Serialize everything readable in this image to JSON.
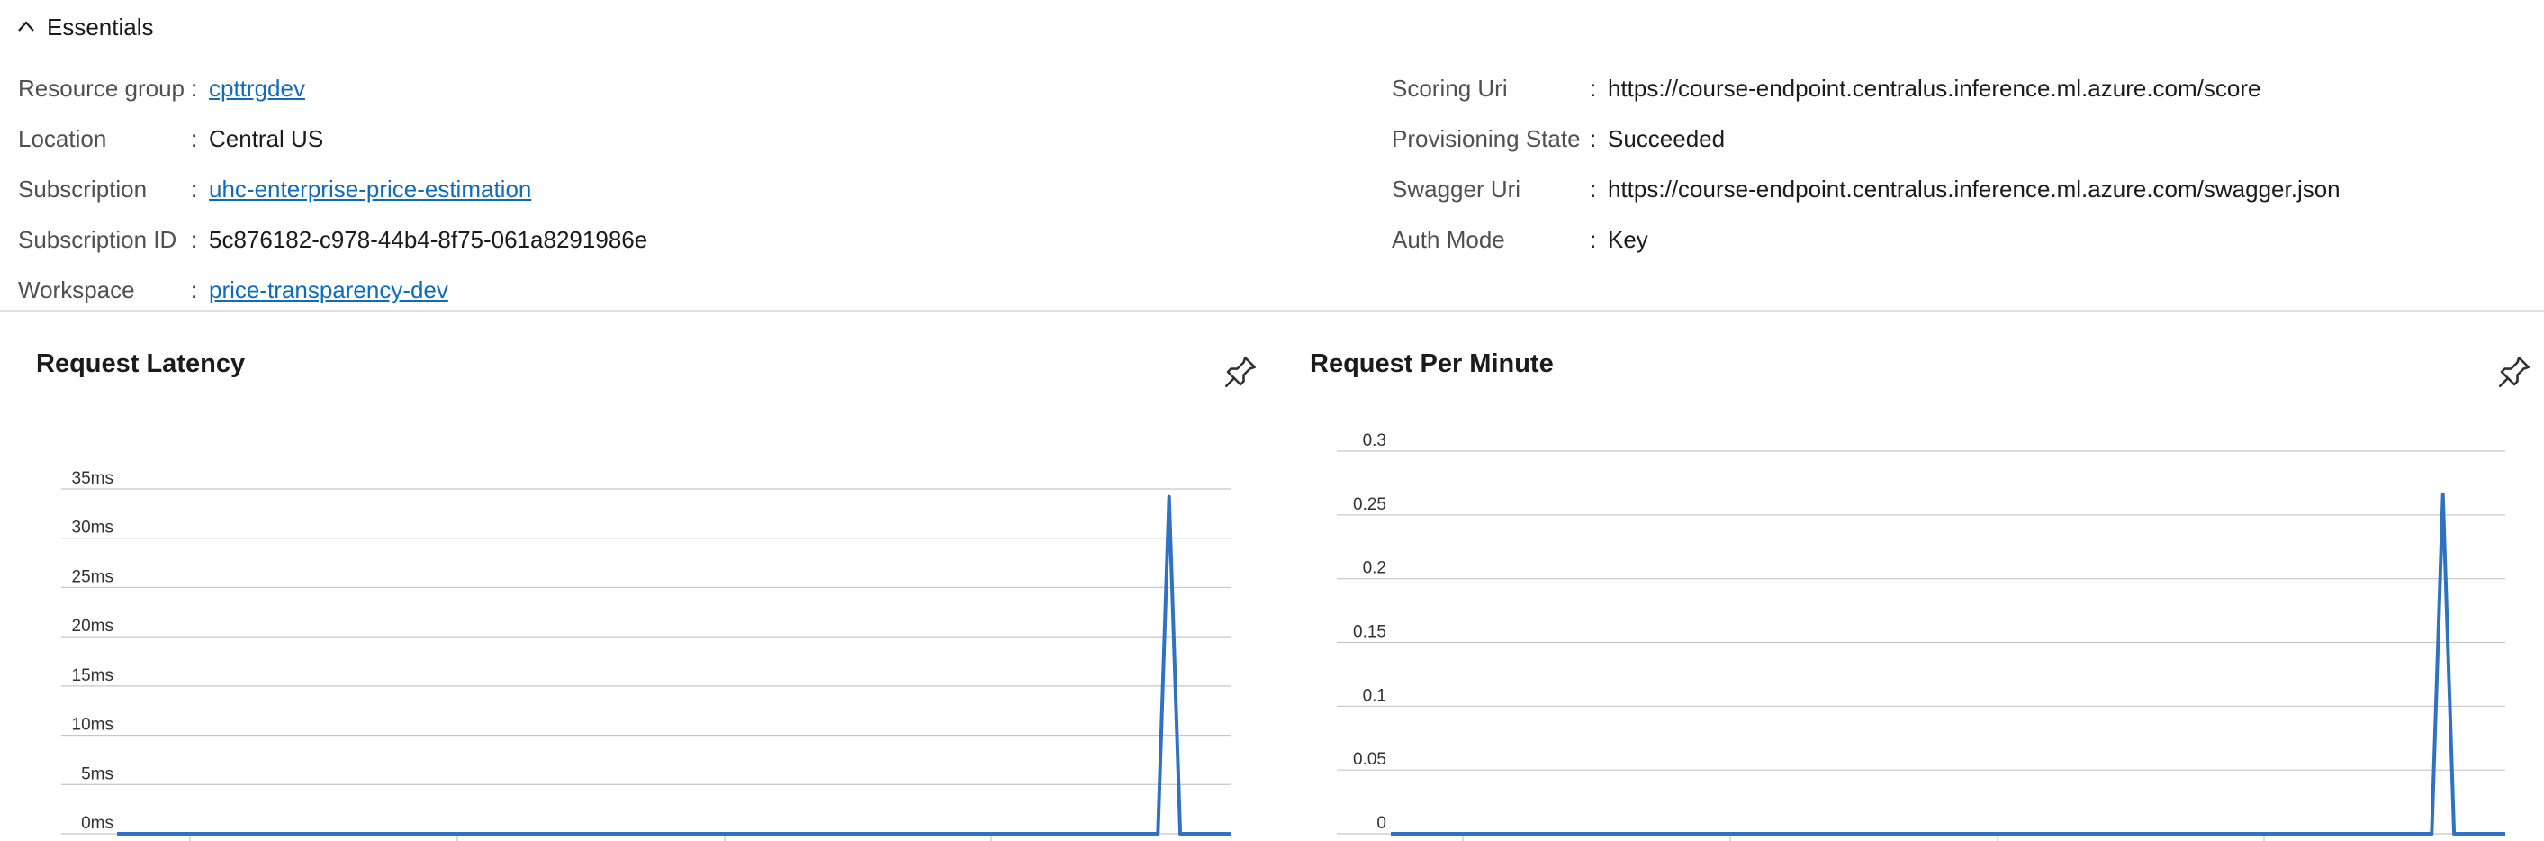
{
  "essentials": {
    "label": "Essentials"
  },
  "properties_left": [
    {
      "label": "Resource group",
      "value": "cpttrgdev",
      "link": true
    },
    {
      "label": "Location",
      "value": "Central US",
      "link": false
    },
    {
      "label": "Subscription",
      "value": "uhc-enterprise-price-estimation",
      "link": true
    },
    {
      "label": "Subscription ID",
      "value": "5c876182-c978-44b4-8f75-061a8291986e",
      "link": false
    },
    {
      "label": "Workspace",
      "value": "price-transparency-dev",
      "link": true
    }
  ],
  "properties_right": [
    {
      "label": "Scoring Uri",
      "value": "https://course-endpoint.centralus.inference.ml.azure.com/score",
      "link": false
    },
    {
      "label": "Provisioning State",
      "value": "Succeeded",
      "link": false
    },
    {
      "label": "Swagger Uri",
      "value": "https://course-endpoint.centralus.inference.ml.azure.com/swagger.json",
      "link": false
    },
    {
      "label": "Auth Mode",
      "value": "Key",
      "link": false
    }
  ],
  "separator": ":",
  "colors": {
    "link": "#0f6cbd",
    "series": "#2f72c4",
    "grid": "#c8c6c4",
    "divider": "#e1dfdd"
  },
  "icons": {
    "collapse": "chevron-up-icon",
    "pin": "pin-icon"
  },
  "chart_data": [
    {
      "type": "line",
      "title": "Request Latency",
      "y_tick_labels": [
        "0ms",
        "5ms",
        "10ms",
        "15ms",
        "20ms",
        "25ms",
        "30ms",
        "35ms"
      ],
      "y_ticks": [
        0,
        5,
        10,
        15,
        20,
        25,
        30,
        35
      ],
      "ylim": [
        0,
        35
      ],
      "xlim": [
        0,
        100
      ],
      "grid": true,
      "series": [
        {
          "points": [
            [
              0,
              0
            ],
            [
              93.4,
              0
            ],
            [
              94.4,
              34.2
            ],
            [
              95.4,
              0
            ],
            [
              100,
              0
            ]
          ]
        }
      ]
    },
    {
      "type": "line",
      "title": "Request Per Minute",
      "y_tick_labels": [
        "0",
        "0.05",
        "0.1",
        "0.15",
        "0.2",
        "0.25",
        "0.3"
      ],
      "y_ticks": [
        0,
        0.05,
        0.1,
        0.15,
        0.2,
        0.25,
        0.3
      ],
      "ylim": [
        0,
        0.3
      ],
      "xlim": [
        0,
        100
      ],
      "grid": true,
      "series": [
        {
          "points": [
            [
              0,
              0
            ],
            [
              93.4,
              0
            ],
            [
              94.4,
              0.266
            ],
            [
              95.4,
              0
            ],
            [
              100,
              0
            ]
          ]
        }
      ]
    }
  ]
}
